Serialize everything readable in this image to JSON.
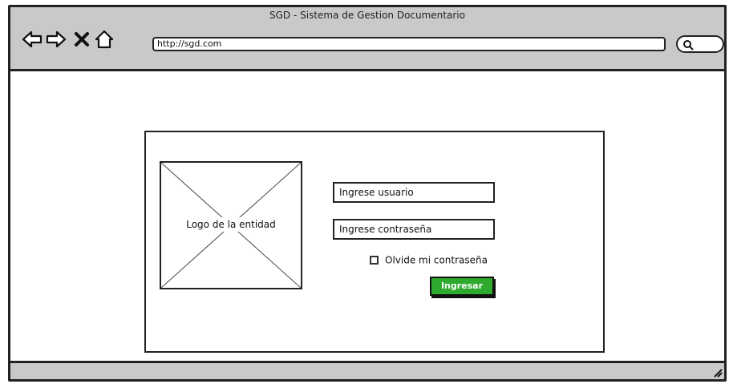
{
  "browser": {
    "title": "SGD - Sistema de Gestion Documentario",
    "url": "http://sgd.com",
    "nav_icons": [
      "back-icon",
      "forward-icon",
      "close-icon",
      "home-icon"
    ],
    "search_icon": "search-icon"
  },
  "login": {
    "logo_label": "Logo de la entidad",
    "user_placeholder": "Ingrese usuario",
    "password_placeholder": "Ingrese contraseña",
    "forgot_label": "Olvide mi contraseña",
    "submit_label": "Ingresar"
  },
  "colors": {
    "chrome": "#c9c9c9",
    "button": "#2eaa2e"
  }
}
